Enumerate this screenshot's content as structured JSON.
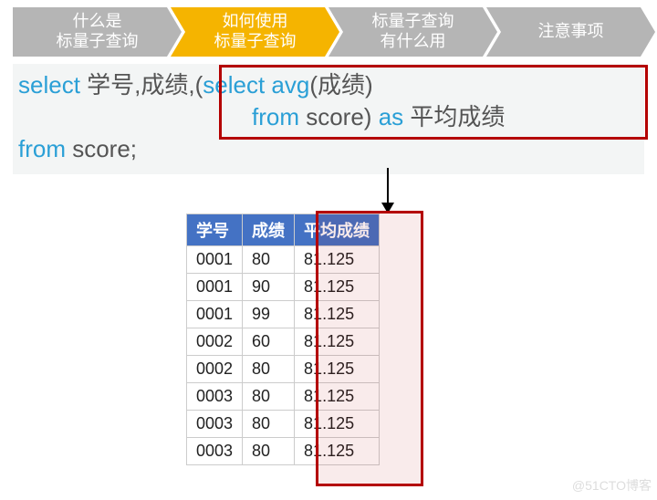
{
  "nav": {
    "items": [
      {
        "l1": "什么是",
        "l2": "标量子查询"
      },
      {
        "l1": "如何使用",
        "l2": "标量子查询"
      },
      {
        "l1": "标量子查询",
        "l2": "有什么用"
      },
      {
        "l1": "注意事项",
        "l2": ""
      }
    ]
  },
  "sql": {
    "l1a": "select",
    "l1b": " 学号,成绩,",
    "l1c": "(",
    "l1d": "select avg",
    "l1e": "(成绩)",
    "l2a": "from",
    "l2b": " score) ",
    "l2c": "as",
    "l2d": " 平均成绩",
    "l3a": "from",
    "l3b": " score;"
  },
  "chart_data": {
    "type": "table",
    "title": "",
    "columns": [
      "学号",
      "成绩",
      "平均成绩"
    ],
    "rows": [
      [
        "0001",
        "80",
        "81.125"
      ],
      [
        "0001",
        "90",
        "81.125"
      ],
      [
        "0001",
        "99",
        "81.125"
      ],
      [
        "0002",
        "60",
        "81.125"
      ],
      [
        "0002",
        "80",
        "81.125"
      ],
      [
        "0003",
        "80",
        "81.125"
      ],
      [
        "0003",
        "80",
        "81.125"
      ],
      [
        "0003",
        "80",
        "81.125"
      ]
    ]
  },
  "watermark": "@51CTO博客"
}
